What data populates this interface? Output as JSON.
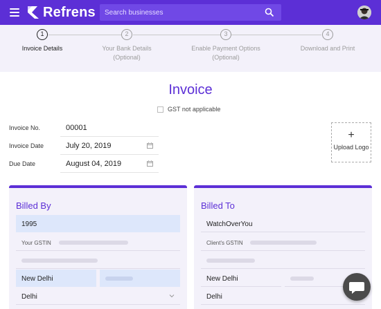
{
  "app": {
    "name": "Refrens"
  },
  "search": {
    "placeholder": "Search businesses"
  },
  "stepper": {
    "steps": [
      {
        "number": "1",
        "label": "Invoice Details",
        "sublabel": ""
      },
      {
        "number": "2",
        "label": "Your Bank Details",
        "sublabel": "(Optional)"
      },
      {
        "number": "3",
        "label": "Enable Payment Options",
        "sublabel": "(Optional)"
      },
      {
        "number": "4",
        "label": "Download and Print",
        "sublabel": ""
      }
    ]
  },
  "invoice": {
    "title": "Invoice",
    "gst_label": "GST not applicable",
    "fields": {
      "invoice_no": {
        "label": "Invoice No.",
        "value": "00001"
      },
      "invoice_date": {
        "label": "Invoice Date",
        "value": "July 20, 2019"
      },
      "due_date": {
        "label": "Due Date",
        "value": "August 04, 2019"
      }
    },
    "upload_logo": {
      "plus": "+",
      "label": "Upload Logo"
    }
  },
  "billed_by": {
    "title": "Billed By",
    "name": "1995",
    "gstin_label": "Your GSTIN",
    "city": "New Delhi",
    "state": "Delhi"
  },
  "billed_to": {
    "title": "Billed To",
    "name": "WatchOverYou",
    "gstin_label": "Client's GSTIN",
    "city": "New Delhi",
    "state": "Delhi"
  },
  "colors": {
    "brand": "#5c2fd6",
    "panel": "#f3f1fa",
    "filled": "#dde7fb"
  }
}
